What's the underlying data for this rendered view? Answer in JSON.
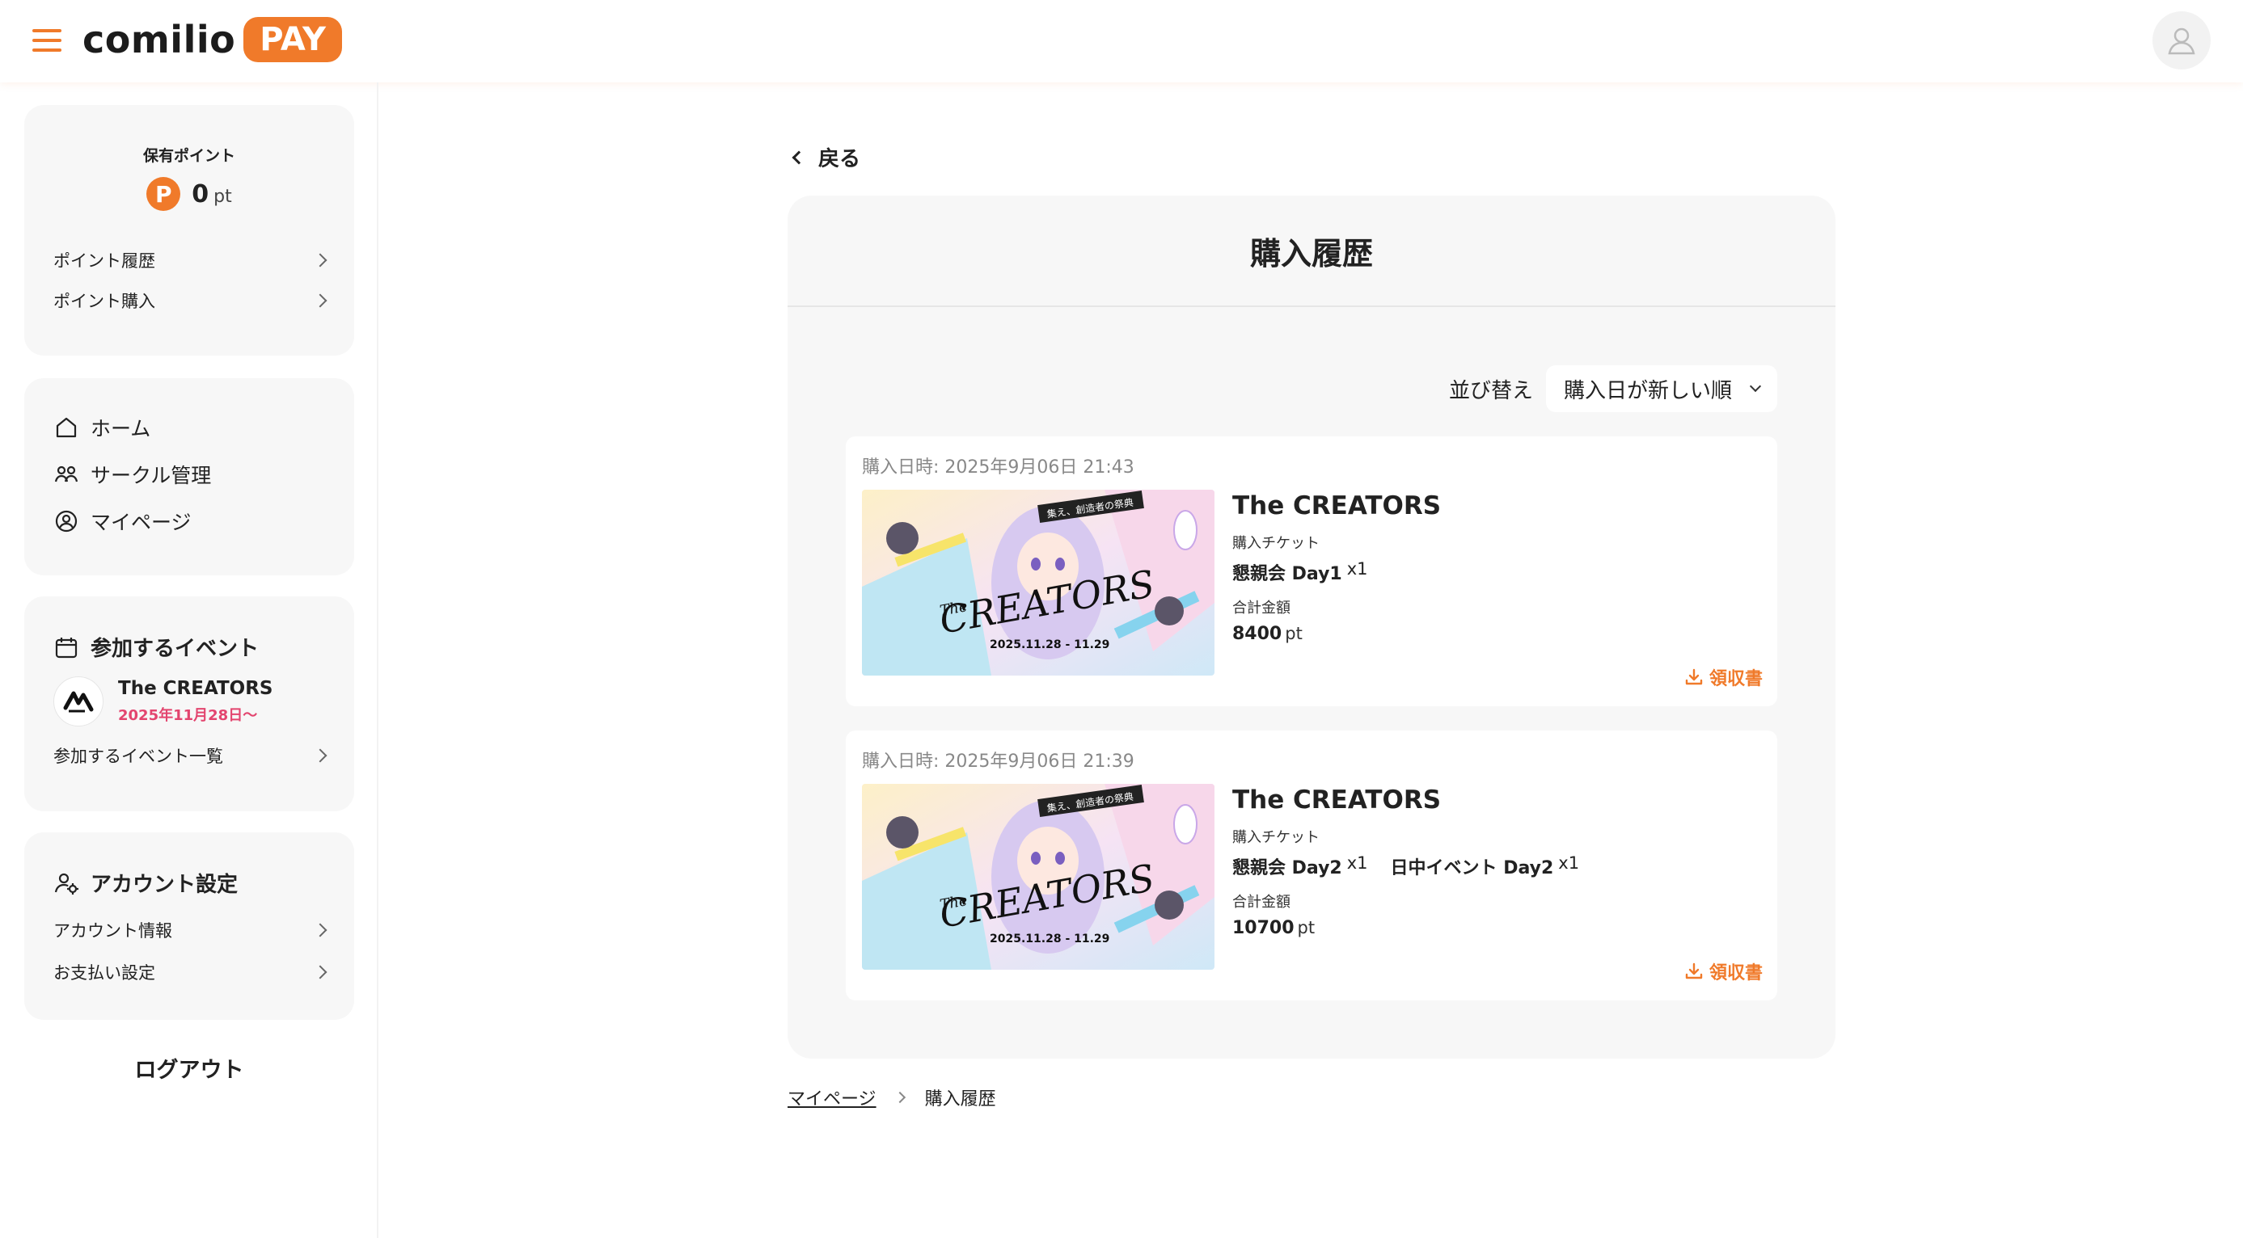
{
  "header": {
    "logo_text": "comilio",
    "logo_badge": "PAY",
    "menu_icon": "hamburger-icon",
    "avatar_icon": "user-icon",
    "accent": "#f07a2a"
  },
  "sidebar": {
    "points": {
      "title": "保有ポイント",
      "badge": "P",
      "value": "0",
      "unit": "pt",
      "links": [
        {
          "label": "ポイント履歴"
        },
        {
          "label": "ポイント購入"
        }
      ]
    },
    "nav": [
      {
        "label": "ホーム",
        "icon": "home-icon"
      },
      {
        "label": "サークル管理",
        "icon": "users-icon"
      },
      {
        "label": "マイページ",
        "icon": "user-circle-icon"
      }
    ],
    "events": {
      "title": "参加するイベント",
      "icon": "calendar-icon",
      "event_name": "The CREATORS",
      "event_date": "2025年11月28日〜",
      "list_link": "参加するイベント一覧"
    },
    "account": {
      "title": "アカウント設定",
      "icon": "user-gear-icon",
      "links": [
        {
          "label": "アカウント情報"
        },
        {
          "label": "お支払い設定"
        }
      ]
    },
    "logout": "ログアウト"
  },
  "main": {
    "back_label": "戻る",
    "title": "購入履歴",
    "sort": {
      "label": "並び替え",
      "selected": "購入日が新しい順"
    },
    "orders": [
      {
        "date": "購入日時: 2025年9月06日 21:43",
        "event": "The CREATORS",
        "ticket_label": "購入チケット",
        "tickets": [
          {
            "name": "懇親会 Day1",
            "qty": "x1"
          }
        ],
        "total_label": "合計金額",
        "total": "8400",
        "unit": "pt",
        "receipt": "領収書",
        "banner_text": {
          "catch": "集え、創造者の祭典",
          "title": "CREATORS",
          "title_prefix": "The",
          "dates": "2025.11.28 - 11.29"
        }
      },
      {
        "date": "購入日時: 2025年9月06日 21:39",
        "event": "The CREATORS",
        "ticket_label": "購入チケット",
        "tickets": [
          {
            "name": "懇親会 Day2",
            "qty": "x1"
          },
          {
            "name": "日中イベント Day2",
            "qty": "x1"
          }
        ],
        "total_label": "合計金額",
        "total": "10700",
        "unit": "pt",
        "receipt": "領収書",
        "banner_text": {
          "catch": "集え、創造者の祭典",
          "title": "CREATORS",
          "title_prefix": "The",
          "dates": "2025.11.28 - 11.29"
        }
      }
    ],
    "breadcrumb": [
      {
        "label": "マイページ"
      },
      {
        "label": "購入履歴"
      }
    ]
  }
}
